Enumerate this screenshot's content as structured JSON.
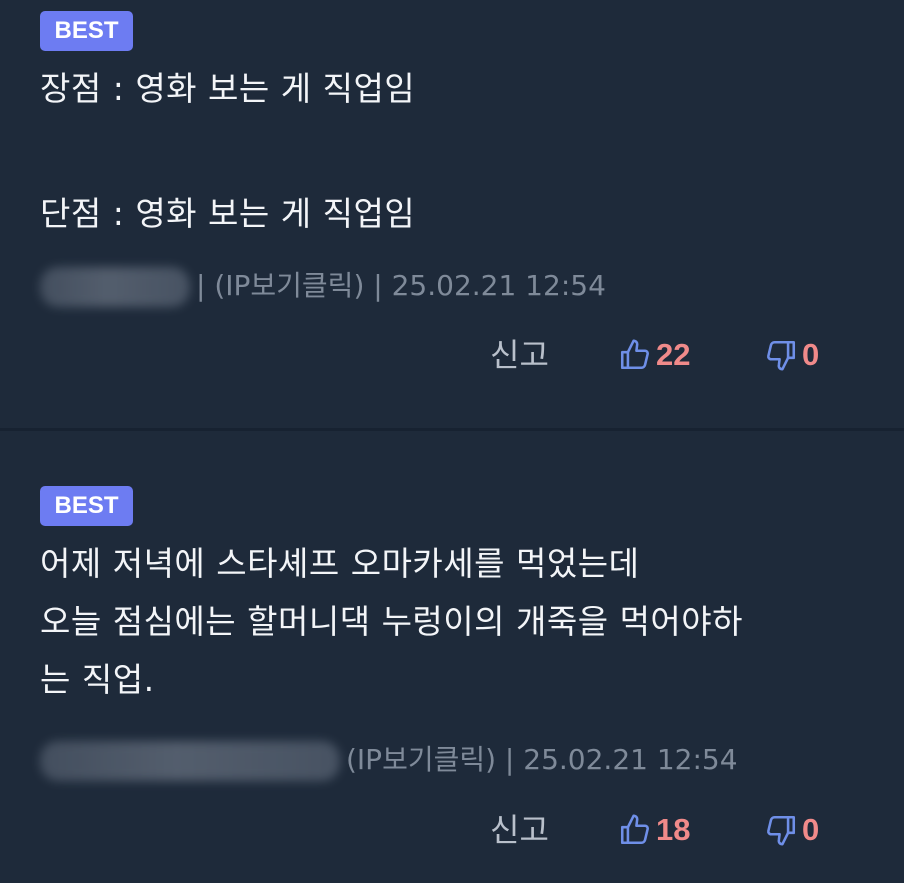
{
  "colors": {
    "background": "#1e2a3a",
    "badge": "#6d7cf2",
    "text": "#f3f5f8",
    "meta": "#7f8a99",
    "count": "#f08a8a",
    "thumb_icon": "#6f8fe8"
  },
  "comments": [
    {
      "badge": "BEST",
      "lines": [
        "장점 : 영화 보는 게 직업임",
        "단점 : 영화 보는 게 직업임"
      ],
      "meta": "| (IP보기클릭) | 25.02.21 12:54",
      "report_label": "신고",
      "like_icon": "thumbs-up-icon",
      "likes": "22",
      "dislike_icon": "thumbs-down-icon",
      "dislikes": "0"
    },
    {
      "badge": "BEST",
      "lines": [
        "어제 저녁에 스타셰프 오마카세를 먹었는데",
        "오늘 점심에는 할머니댁 누렁이의 개죽을 먹어야하",
        "는 직업."
      ],
      "meta": "(IP보기클릭) | 25.02.21 12:54",
      "report_label": "신고",
      "like_icon": "thumbs-up-icon",
      "likes": "18",
      "dislike_icon": "thumbs-down-icon",
      "dislikes": "0"
    }
  ]
}
